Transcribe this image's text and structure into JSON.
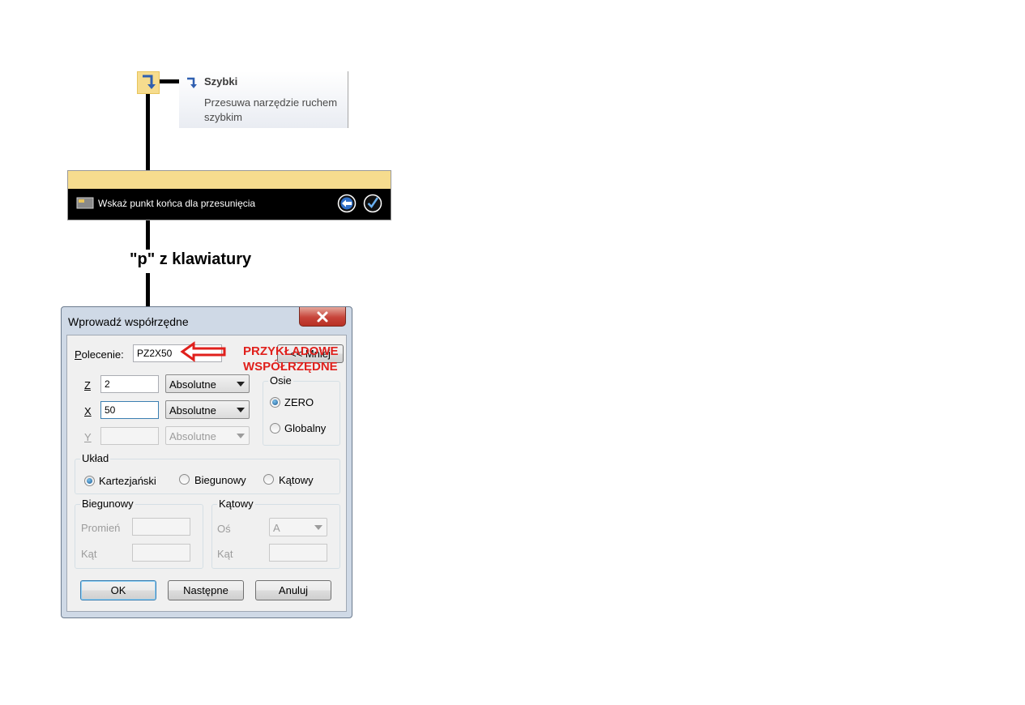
{
  "tooltip": {
    "title": "Szybki",
    "description": "Przesuwa narzędzie ruchem szybkim",
    "icon": "rapid-move-arrow-icon"
  },
  "prompt_bar": {
    "text": "Wskaż punkt końca dla przesunięcia",
    "back_icon": "back-arrow-icon",
    "accept_icon": "checkmark-icon"
  },
  "keyboard_label": "\"p\" z klawiatury",
  "dialog": {
    "title": "Wprowadź współrzędne",
    "close_icon": "close-x-icon",
    "command": {
      "label": "Polecenie:",
      "value": "PZ2X50",
      "less_button": "<< Mniej"
    },
    "coords": [
      {
        "axis": "Z",
        "value": "2",
        "mode": "Absolutne",
        "enabled": true
      },
      {
        "axis": "X",
        "value": "50",
        "mode": "Absolutne",
        "enabled": true
      },
      {
        "axis": "Y",
        "value": "",
        "mode": "Absolutne",
        "enabled": false
      }
    ],
    "axes_group": {
      "title": "Osie",
      "options": [
        "ZERO",
        "Globalny"
      ],
      "selected": "ZERO"
    },
    "system_group": {
      "title": "Układ",
      "options": [
        "Kartezjański",
        "Biegunowy",
        "Kątowy"
      ],
      "selected": "Kartezjański"
    },
    "polar_group": {
      "title": "Biegunowy",
      "radius_label": "Promień",
      "angle_label": "Kąt"
    },
    "angular_group": {
      "title": "Kątowy",
      "axis_label": "Oś",
      "axis_value": "A",
      "angle_label": "Kąt"
    },
    "buttons": {
      "ok": "OK",
      "next": "Następne",
      "cancel": "Anuluj"
    }
  },
  "annotation": {
    "line1": "PRZYKŁADOWE",
    "line2": "WSPÓŁRZĘDNE",
    "color": "#e0201c"
  }
}
